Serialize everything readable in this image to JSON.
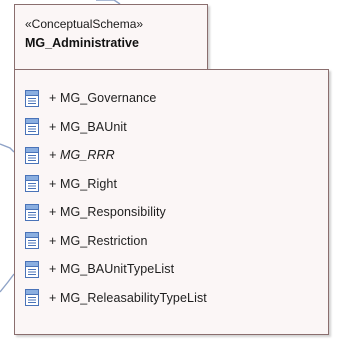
{
  "package": {
    "stereotype": "«ConceptualSchema»",
    "name": "MG_Administrative"
  },
  "classes": [
    {
      "label": "+ MG_Governance",
      "abstract": false,
      "icon": "class-icon"
    },
    {
      "label": "+ MG_BAUnit",
      "abstract": false,
      "icon": "class-icon"
    },
    {
      "label": "+ MG_RRR",
      "abstract": true,
      "icon": "class-icon"
    },
    {
      "label": "+ MG_Right",
      "abstract": false,
      "icon": "class-icon"
    },
    {
      "label": "+ MG_Responsibility",
      "abstract": false,
      "icon": "class-icon"
    },
    {
      "label": "+ MG_Restriction",
      "abstract": false,
      "icon": "class-icon"
    },
    {
      "label": "+ MG_BAUnitTypeList",
      "abstract": false,
      "icon": "class-icon"
    },
    {
      "label": "+ MG_ReleasabilityTypeList",
      "abstract": false,
      "icon": "class-icon"
    }
  ],
  "colors": {
    "fill": "#fbf6f6",
    "border": "#8a6e6e",
    "connector": "#8fa3c7",
    "icon_border": "#4a73b8",
    "icon_header": "#8aaee0"
  }
}
